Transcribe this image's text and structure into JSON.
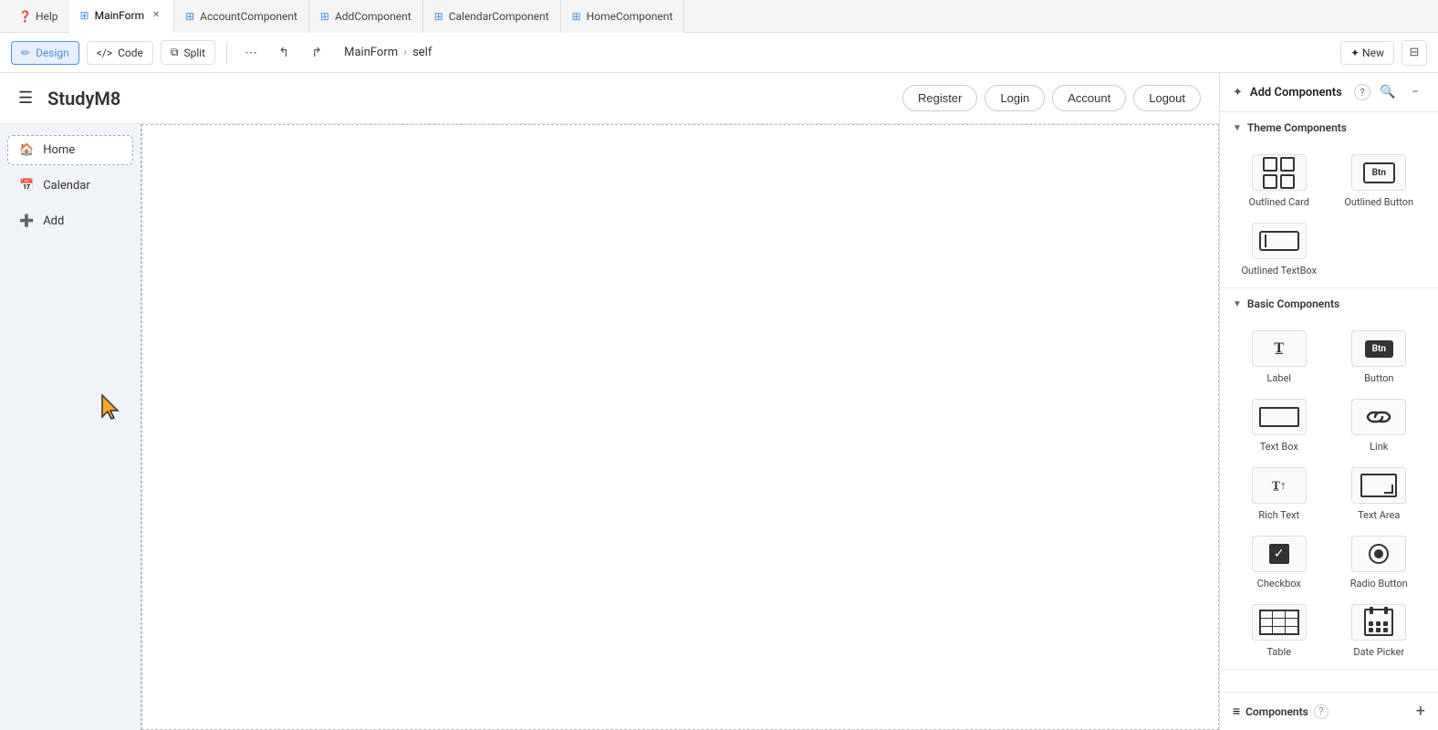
{
  "tab_bar": {
    "help_label": "Help",
    "tabs": [
      {
        "id": "main-form",
        "label": "MainForm",
        "active": true,
        "closeable": true
      },
      {
        "id": "account-component",
        "label": "AccountComponent",
        "active": false,
        "closeable": false
      },
      {
        "id": "add-component",
        "label": "AddComponent",
        "active": false,
        "closeable": false
      },
      {
        "id": "calendar-component",
        "label": "CalendarComponent",
        "active": false,
        "closeable": false
      },
      {
        "id": "home-component",
        "label": "HomeComponent",
        "active": false,
        "closeable": false
      }
    ]
  },
  "toolbar": {
    "design_label": "Design",
    "code_label": "Code",
    "split_label": "Split",
    "breadcrumb_form": "MainForm",
    "breadcrumb_self": "self",
    "new_label": "✦ New"
  },
  "app_preview": {
    "logo": "StudyM8",
    "nav_buttons": [
      "Register",
      "Login",
      "Account",
      "Logout"
    ],
    "sidebar_items": [
      {
        "id": "home",
        "icon": "🏠",
        "label": "Home",
        "selected": true
      },
      {
        "id": "calendar",
        "icon": "📅",
        "label": "Calendar",
        "selected": false
      },
      {
        "id": "add",
        "icon": "➕",
        "label": "Add",
        "selected": false
      }
    ]
  },
  "right_panel": {
    "title": "Add Components",
    "help_icon": "?",
    "search_icon": "🔍",
    "collapse_icon": "−",
    "sections": {
      "theme": {
        "label": "Theme Components",
        "components": [
          {
            "id": "outlined-card",
            "label": "Outlined Card"
          },
          {
            "id": "outlined-button",
            "label": "Outlined Button"
          },
          {
            "id": "outlined-textbox",
            "label": "Outlined TextBox"
          }
        ]
      },
      "basic": {
        "label": "Basic Components",
        "components": [
          {
            "id": "label",
            "label": "Label"
          },
          {
            "id": "button",
            "label": "Button"
          },
          {
            "id": "text-box",
            "label": "Text Box"
          },
          {
            "id": "link",
            "label": "Link"
          },
          {
            "id": "rich-text",
            "label": "Rich Text"
          },
          {
            "id": "text-area",
            "label": "Text Area"
          },
          {
            "id": "checkbox",
            "label": "Checkbox"
          },
          {
            "id": "radio-button",
            "label": "Radio Button"
          },
          {
            "id": "table",
            "label": "Table"
          },
          {
            "id": "date-picker",
            "label": "Date Picker"
          }
        ]
      }
    },
    "footer": {
      "label": "Components",
      "add_icon": "+"
    }
  }
}
